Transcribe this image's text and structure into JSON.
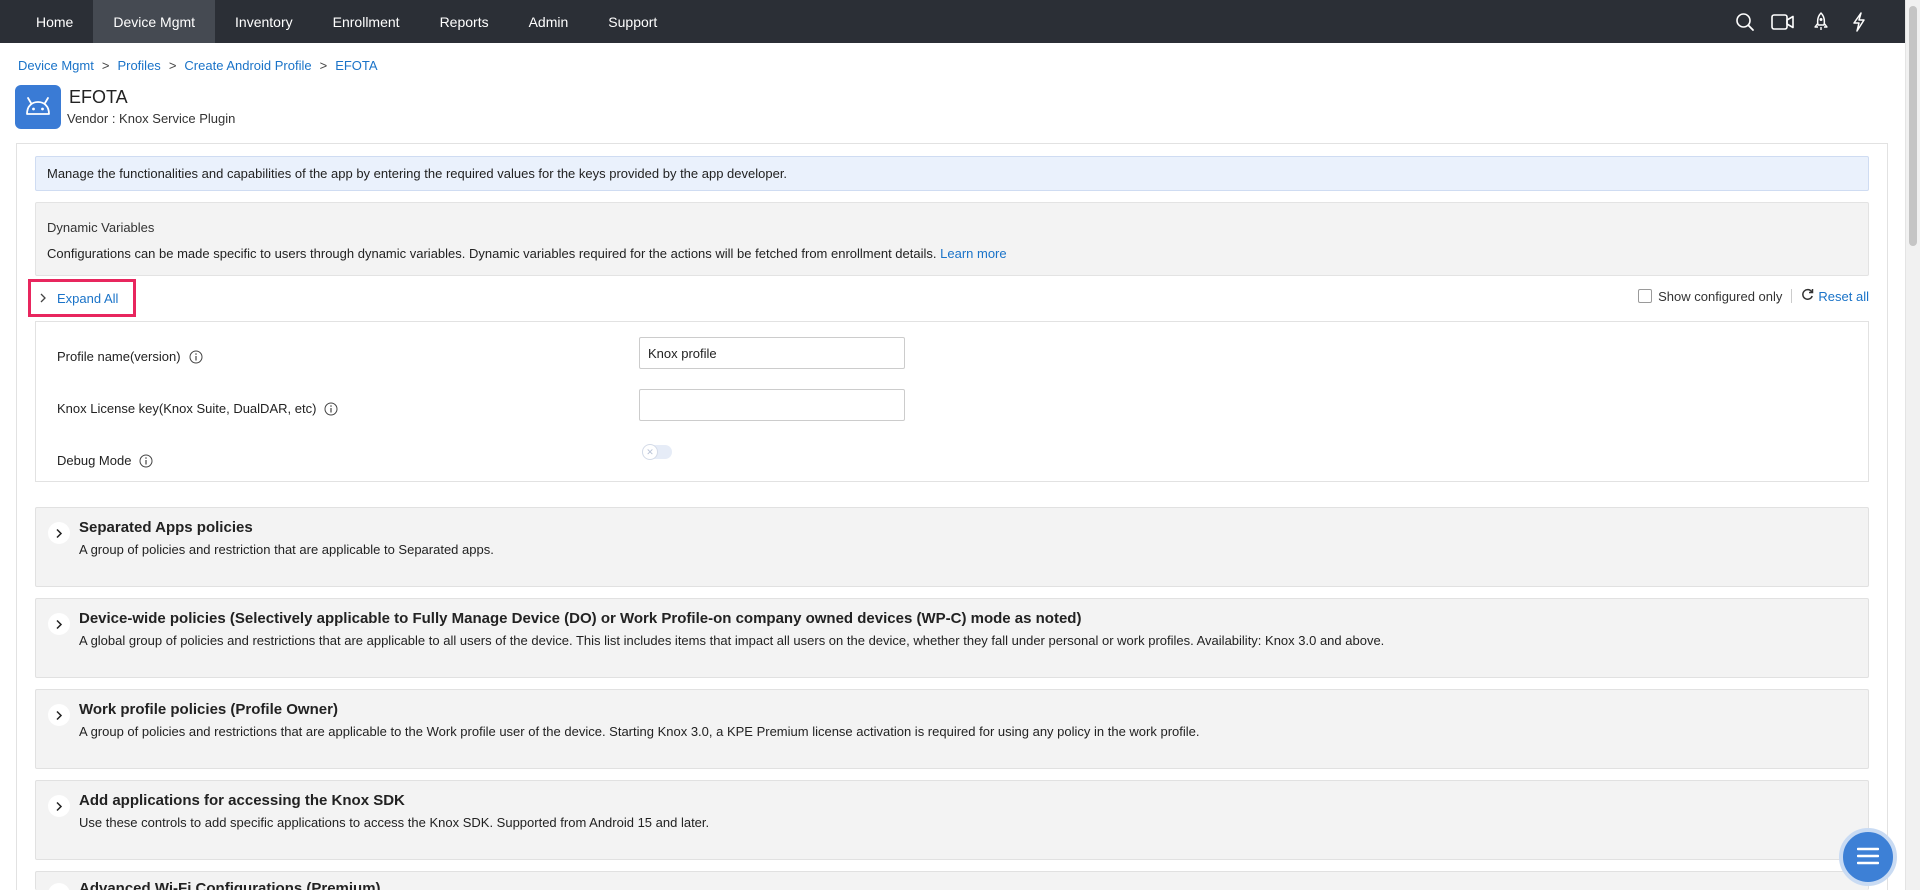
{
  "nav": {
    "tabs": [
      "Home",
      "Device Mgmt",
      "Inventory",
      "Enrollment",
      "Reports",
      "Admin",
      "Support"
    ],
    "active_tab": "Device Mgmt",
    "icons": [
      "search-icon",
      "video-icon",
      "rocket-icon",
      "lightning-icon"
    ]
  },
  "breadcrumb": {
    "items": [
      "Device Mgmt",
      "Profiles",
      "Create Android Profile",
      "EFOTA"
    ],
    "separator": ">"
  },
  "header": {
    "icon": "android-icon",
    "title": "EFOTA",
    "vendor": "Vendor : Knox Service Plugin"
  },
  "info_bar": {
    "text": "Manage the functionalities and capabilities of the app by entering the required values for the keys provided by the app developer."
  },
  "dynamic_variables": {
    "title": "Dynamic Variables",
    "description": "Configurations can be made specific to users through dynamic variables. Dynamic variables required for the actions will be fetched from enrollment details.",
    "link": "Learn more"
  },
  "controls": {
    "expand_all": "Expand All",
    "show_configured_only": "Show configured only",
    "show_configured_checked": false,
    "reset_all": "Reset all"
  },
  "fields": {
    "profile_name": {
      "label": "Profile name(version)",
      "value": "Knox profile"
    },
    "license_key": {
      "label": "Knox License key(Knox Suite, DualDAR, etc)",
      "value": ""
    },
    "debug_mode": {
      "label": "Debug Mode",
      "enabled": false
    }
  },
  "sections": [
    {
      "title": "Separated Apps policies",
      "description": "A group of policies and restriction that are applicable to Separated apps."
    },
    {
      "title": "Device-wide policies (Selectively applicable to Fully Manage Device (DO) or Work Profile-on company owned devices (WP-C) mode as noted)",
      "description": "A global group of policies and restrictions that are applicable to all users of the device. This list includes items that impact all users on the device, whether they fall under personal or work profiles. Availability: Knox 3.0 and above."
    },
    {
      "title": "Work profile policies (Profile Owner)",
      "description": "A group of policies and restrictions that are applicable to the Work profile user of the device. Starting Knox 3.0, a KPE Premium license activation is required for using any policy in the work profile."
    },
    {
      "title": "Add applications for accessing the Knox SDK",
      "description": "Use these controls to add specific applications to access the Knox SDK. Supported from Android 15 and later."
    },
    {
      "title": "Advanced Wi-Fi Configurations (Premium)",
      "description": ""
    }
  ],
  "colors": {
    "nav_bg": "#2b2f36",
    "nav_active": "#454a52",
    "link": "#1a73c8",
    "highlight_border": "#e8265e",
    "app_icon": "#3a7bd5",
    "info_bar_bg": "#eaf1fc"
  }
}
